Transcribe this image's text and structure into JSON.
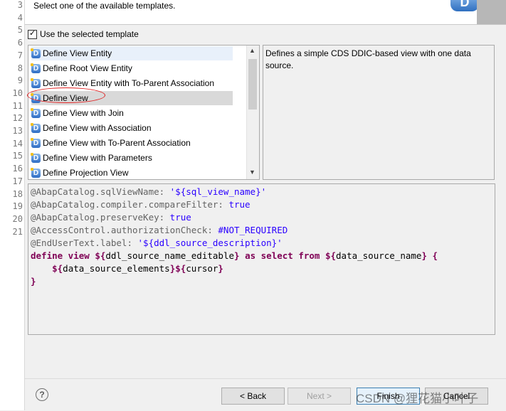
{
  "editor": {
    "line_numbers": [
      "3",
      "4",
      "5",
      "6",
      "7",
      "8",
      "9",
      "10",
      "11",
      "12",
      "13",
      "14",
      "15",
      "16",
      "17",
      "18",
      "19",
      "20",
      "21"
    ]
  },
  "wizard": {
    "description": "Select one of the available templates.",
    "logo_glyph": "D",
    "use_template_label": "Use the selected template",
    "use_template_checked": true
  },
  "templates": {
    "items": [
      {
        "label": "Define View Entity",
        "icon": "ddic-template-icon"
      },
      {
        "label": "Define Root View Entity",
        "icon": "ddic-template-icon"
      },
      {
        "label": "Define View Entity with To-Parent Association",
        "icon": "ddic-template-icon"
      },
      {
        "label": "Define View",
        "icon": "ddic-template-icon"
      },
      {
        "label": "Define View with Join",
        "icon": "ddic-template-icon"
      },
      {
        "label": "Define View with Association",
        "icon": "ddic-template-icon"
      },
      {
        "label": "Define View with To-Parent Association",
        "icon": "ddic-template-icon"
      },
      {
        "label": "Define View with Parameters",
        "icon": "ddic-template-icon"
      },
      {
        "label": "Define Projection View",
        "icon": "ddic-template-icon"
      }
    ],
    "selected_index": 3,
    "template_description": "Defines a simple CDS DDIC-based view with one data source."
  },
  "preview": {
    "lines": [
      [
        {
          "t": "@AbapCatalog.sqlViewName: ",
          "c": "ann"
        },
        {
          "t": "'${sql_view_name}'",
          "c": "str"
        }
      ],
      [
        {
          "t": "@AbapCatalog.compiler.compareFilter: ",
          "c": "ann"
        },
        {
          "t": "true",
          "c": "str"
        }
      ],
      [
        {
          "t": "@AbapCatalog.preserveKey: ",
          "c": "ann"
        },
        {
          "t": "true",
          "c": "str"
        }
      ],
      [
        {
          "t": "@AccessControl.authorizationCheck: ",
          "c": "ann"
        },
        {
          "t": "#NOT_REQUIRED",
          "c": "str"
        }
      ],
      [
        {
          "t": "@EndUserText.label: ",
          "c": "ann"
        },
        {
          "t": "'${ddl_source_description}'",
          "c": "str"
        }
      ],
      [
        {
          "t": "define view ",
          "c": "kw"
        },
        {
          "t": "${",
          "c": "kw"
        },
        {
          "t": "ddl_source_name_editable",
          "c": "plain"
        },
        {
          "t": "} ",
          "c": "kw"
        },
        {
          "t": "as select from ",
          "c": "kw"
        },
        {
          "t": "${",
          "c": "kw"
        },
        {
          "t": "data_source_name",
          "c": "plain"
        },
        {
          "t": "} {",
          "c": "kw"
        }
      ],
      [
        {
          "t": "    ",
          "c": "plain"
        },
        {
          "t": "${",
          "c": "kw"
        },
        {
          "t": "data_source_elements",
          "c": "plain"
        },
        {
          "t": "}${",
          "c": "kw"
        },
        {
          "t": "cursor",
          "c": "plain"
        },
        {
          "t": "}",
          "c": "kw"
        }
      ],
      [
        {
          "t": "}",
          "c": "kw"
        }
      ]
    ]
  },
  "buttons": {
    "help_glyph": "?",
    "back": "< Back",
    "next": "Next >",
    "finish": "Finish",
    "cancel": "Cancel"
  },
  "watermark": "CSDN @狸花猫小叶子"
}
